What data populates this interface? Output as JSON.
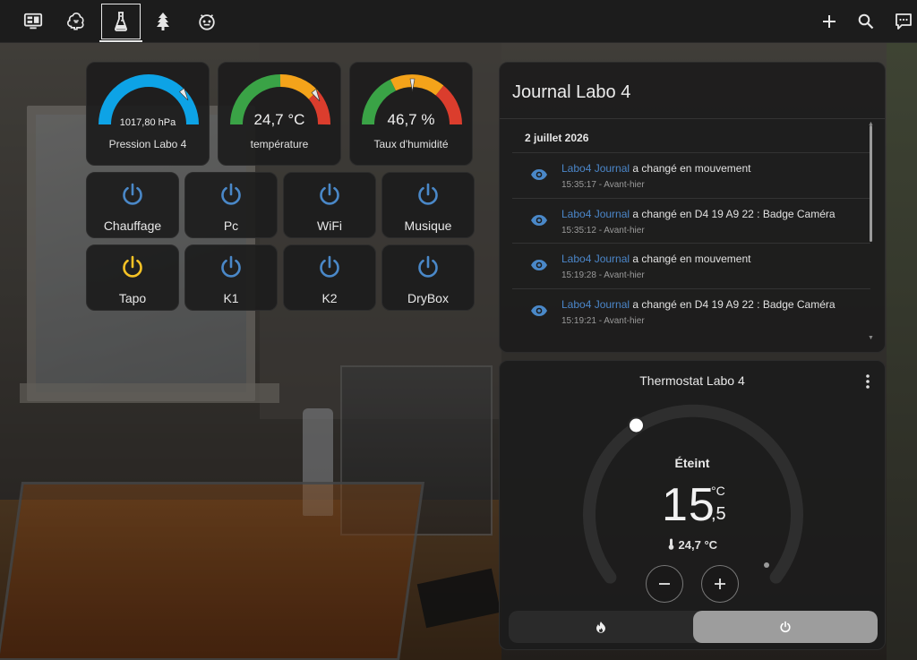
{
  "topbar": {
    "tabs": [
      {
        "icon": "monitor-dashboard-icon",
        "active": false
      },
      {
        "icon": "brain-icon",
        "active": false
      },
      {
        "icon": "flask-icon",
        "active": true
      },
      {
        "icon": "pine-tree-icon",
        "active": false
      },
      {
        "icon": "robot-face-icon",
        "active": false
      }
    ],
    "actions": [
      "plus-icon",
      "search-icon",
      "assist-chat-icon"
    ]
  },
  "gauges": [
    {
      "value_text": "1017,80 hPa",
      "label": "Pression Labo 4",
      "fraction": 0.92
    },
    {
      "value_text": "24,7 °C",
      "label": "température",
      "fraction": 0.9
    },
    {
      "value_text": "46,7 %",
      "label": "Taux d'humidité",
      "fraction": 0.47
    }
  ],
  "buttons": [
    {
      "label": "Chauffage",
      "state": "off",
      "color": "#4a88c8"
    },
    {
      "label": "Pc",
      "state": "off",
      "color": "#4a88c8"
    },
    {
      "label": "WiFi",
      "state": "off",
      "color": "#4a88c8"
    },
    {
      "label": "Musique",
      "state": "off",
      "color": "#4a88c8"
    },
    {
      "label": "Tapo",
      "state": "on",
      "color": "#f7c325"
    },
    {
      "label": "K1",
      "state": "off",
      "color": "#4a88c8"
    },
    {
      "label": "K2",
      "state": "off",
      "color": "#4a88c8"
    },
    {
      "label": "DryBox",
      "state": "off",
      "color": "#4a88c8"
    }
  ],
  "journal": {
    "title": "Journal Labo 4",
    "date": "2 juillet 2026",
    "entries": [
      {
        "entity": "Labo4 Journal",
        "message": " a changé en mouvement",
        "time": "15:35:17 - Avant-hier"
      },
      {
        "entity": "Labo4 Journal",
        "message": " a changé en D4 19 A9 22 : Badge Caméra",
        "time": "15:35:12 - Avant-hier"
      },
      {
        "entity": "Labo4 Journal",
        "message": " a changé en mouvement",
        "time": "15:19:28 - Avant-hier"
      },
      {
        "entity": "Labo4 Journal",
        "message": " a changé en D4 19 A9 22 : Badge Caméra",
        "time": "15:19:21 - Avant-hier"
      }
    ]
  },
  "thermostat": {
    "title": "Thermostat Labo 4",
    "state": "Éteint",
    "target_int": "15",
    "target_dec": ",5",
    "unit": "°C",
    "current": "24,7 °C",
    "modes": [
      "heat",
      "off"
    ],
    "active_mode": "off"
  },
  "colors": {
    "accent_blue": "#4a88c8",
    "gauge_blue": "#0da3e6",
    "gauge_green": "#3aa346",
    "gauge_orange": "#f4a31a",
    "gauge_red": "#db3d2d",
    "active_yellow": "#f7c325"
  }
}
